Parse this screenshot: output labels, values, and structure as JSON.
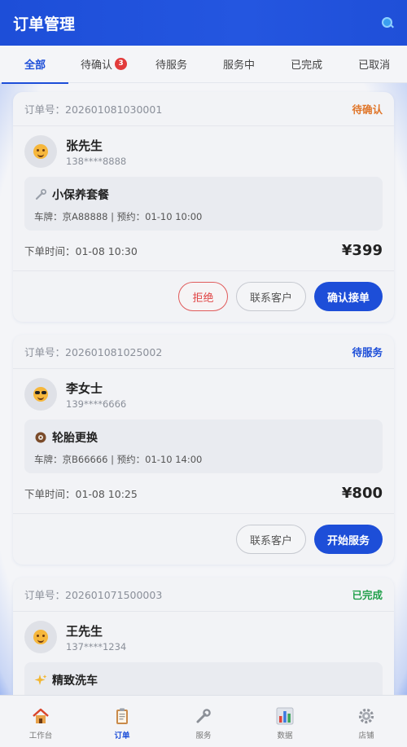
{
  "header": {
    "title": "订单管理",
    "search_icon": "search-icon"
  },
  "tabs": [
    {
      "label": "全部",
      "active": true
    },
    {
      "label": "待确认",
      "badge": "3"
    },
    {
      "label": "待服务"
    },
    {
      "label": "服务中"
    },
    {
      "label": "已完成"
    },
    {
      "label": "已取消"
    }
  ],
  "orders": [
    {
      "order_no": "订单号：202601081030001",
      "status": "待确认",
      "status_color": "#e0762a",
      "customer_name": "张先生",
      "phone": "138****8888",
      "avatar_icon": "smiley-face-icon",
      "service_icon": "wrench-icon",
      "service_title": "小保养套餐",
      "service_detail": "车牌：京A88888 | 预约：01-10 10:00",
      "order_time": "下单时间：01-08 10:30",
      "price": "¥399",
      "buttons": {
        "reject": "拒绝",
        "contact": "联系客户",
        "primary": "确认接单"
      }
    },
    {
      "order_no": "订单号：202601081025002",
      "status": "待服务",
      "status_color": "#1d4ed8",
      "customer_name": "李女士",
      "phone": "139****6666",
      "avatar_icon": "sunglasses-face-icon",
      "service_icon": "tire-icon",
      "service_title": "轮胎更换",
      "service_detail": "车牌：京B66666 | 预约：01-10 14:00",
      "order_time": "下单时间：01-08 10:25",
      "price": "¥800",
      "buttons": {
        "contact": "联系客户",
        "primary": "开始服务"
      }
    },
    {
      "order_no": "订单号：202601071500003",
      "status": "已完成",
      "status_color": "#22a04b",
      "customer_name": "王先生",
      "phone": "137****1234",
      "avatar_icon": "smiley-face-icon",
      "service_icon": "sparkles-icon",
      "service_title": "精致洗车"
    }
  ],
  "bottom_nav": [
    {
      "label": "工作台",
      "icon": "house-icon"
    },
    {
      "label": "订单",
      "icon": "clipboard-icon",
      "active": true
    },
    {
      "label": "服务",
      "icon": "wrench-icon"
    },
    {
      "label": "数据",
      "icon": "bar-chart-icon"
    },
    {
      "label": "店铺",
      "icon": "gear-icon"
    }
  ],
  "colors": {
    "primary": "#1d4ed8",
    "danger": "#e04545",
    "warning": "#e0762a",
    "success": "#22a04b"
  }
}
